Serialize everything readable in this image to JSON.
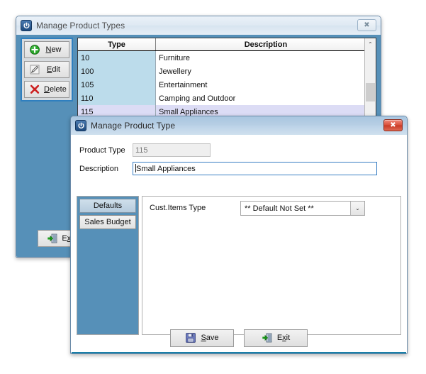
{
  "colors": {
    "window_body_blue": "#5690b8",
    "grid_type_col": "#bcdceb",
    "grid_selected_row": "#dcdcf5",
    "accent_line": "#1a7fa8",
    "focus_border": "#3a7fc4",
    "close_red": "#d9503c",
    "new_icon_green": "#2aa82a",
    "delete_icon_red": "#cc2020"
  },
  "back_window": {
    "title": "Manage Product Types",
    "app_icon": "power-icon",
    "close_label": "Close",
    "close_glyph": "✖",
    "toolbar": [
      {
        "label": "New",
        "accel": "N",
        "icon": "plus-circle-icon"
      },
      {
        "label": "Edit",
        "accel": "E",
        "icon": "pencil-icon"
      },
      {
        "label": "Delete",
        "accel": "D",
        "icon": "x-mark-icon"
      }
    ],
    "exit": {
      "label": "Exit",
      "accel": "x",
      "icon": "exit-door-icon"
    },
    "grid": {
      "columns": [
        "Type",
        "Description"
      ],
      "rows": [
        {
          "type": "10",
          "description": "Furniture",
          "selected": false
        },
        {
          "type": "100",
          "description": "Jewellery",
          "selected": false
        },
        {
          "type": "105",
          "description": "Entertainment",
          "selected": false
        },
        {
          "type": "110",
          "description": "Camping and Outdoor",
          "selected": false
        },
        {
          "type": "115",
          "description": "Small Appliances",
          "selected": true
        }
      ],
      "scrollbar": {
        "up_arrow": "⌃"
      }
    }
  },
  "front_window": {
    "title": "Manage Product Type",
    "app_icon": "power-icon",
    "close_label": "Close",
    "close_glyph": "✖",
    "fields": {
      "product_type": {
        "label": "Product Type",
        "value": "115",
        "placeholder": "",
        "readonly": true
      },
      "description": {
        "label": "Description",
        "value": "Small Appliances",
        "placeholder": "",
        "focused": true
      }
    },
    "tabs": [
      {
        "label": "Defaults",
        "selected": true
      },
      {
        "label": "Sales Budget",
        "selected": false
      }
    ],
    "tab_content": {
      "cust_items": {
        "label": "Cust.Items Type",
        "selected_option": "** Default Not Set **",
        "options": [
          "** Default Not Set **"
        ],
        "arrow_glyph": "⌄"
      }
    },
    "footer": {
      "save": {
        "label": "Save",
        "accel": "S",
        "icon": "floppy-disk-icon"
      },
      "exit": {
        "label": "Exit",
        "accel": "x",
        "icon": "exit-door-icon"
      }
    }
  }
}
